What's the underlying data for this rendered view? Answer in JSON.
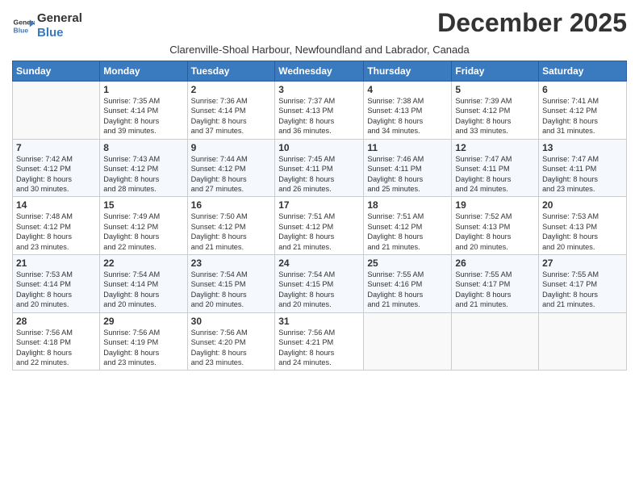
{
  "logo": {
    "line1": "General",
    "line2": "Blue"
  },
  "title": "December 2025",
  "subtitle": "Clarenville-Shoal Harbour, Newfoundland and Labrador, Canada",
  "days_of_week": [
    "Sunday",
    "Monday",
    "Tuesday",
    "Wednesday",
    "Thursday",
    "Friday",
    "Saturday"
  ],
  "weeks": [
    [
      {
        "day": "",
        "content": ""
      },
      {
        "day": "1",
        "content": "Sunrise: 7:35 AM\nSunset: 4:14 PM\nDaylight: 8 hours\nand 39 minutes."
      },
      {
        "day": "2",
        "content": "Sunrise: 7:36 AM\nSunset: 4:14 PM\nDaylight: 8 hours\nand 37 minutes."
      },
      {
        "day": "3",
        "content": "Sunrise: 7:37 AM\nSunset: 4:13 PM\nDaylight: 8 hours\nand 36 minutes."
      },
      {
        "day": "4",
        "content": "Sunrise: 7:38 AM\nSunset: 4:13 PM\nDaylight: 8 hours\nand 34 minutes."
      },
      {
        "day": "5",
        "content": "Sunrise: 7:39 AM\nSunset: 4:12 PM\nDaylight: 8 hours\nand 33 minutes."
      },
      {
        "day": "6",
        "content": "Sunrise: 7:41 AM\nSunset: 4:12 PM\nDaylight: 8 hours\nand 31 minutes."
      }
    ],
    [
      {
        "day": "7",
        "content": "Sunrise: 7:42 AM\nSunset: 4:12 PM\nDaylight: 8 hours\nand 30 minutes."
      },
      {
        "day": "8",
        "content": "Sunrise: 7:43 AM\nSunset: 4:12 PM\nDaylight: 8 hours\nand 28 minutes."
      },
      {
        "day": "9",
        "content": "Sunrise: 7:44 AM\nSunset: 4:12 PM\nDaylight: 8 hours\nand 27 minutes."
      },
      {
        "day": "10",
        "content": "Sunrise: 7:45 AM\nSunset: 4:11 PM\nDaylight: 8 hours\nand 26 minutes."
      },
      {
        "day": "11",
        "content": "Sunrise: 7:46 AM\nSunset: 4:11 PM\nDaylight: 8 hours\nand 25 minutes."
      },
      {
        "day": "12",
        "content": "Sunrise: 7:47 AM\nSunset: 4:11 PM\nDaylight: 8 hours\nand 24 minutes."
      },
      {
        "day": "13",
        "content": "Sunrise: 7:47 AM\nSunset: 4:11 PM\nDaylight: 8 hours\nand 23 minutes."
      }
    ],
    [
      {
        "day": "14",
        "content": "Sunrise: 7:48 AM\nSunset: 4:12 PM\nDaylight: 8 hours\nand 23 minutes."
      },
      {
        "day": "15",
        "content": "Sunrise: 7:49 AM\nSunset: 4:12 PM\nDaylight: 8 hours\nand 22 minutes."
      },
      {
        "day": "16",
        "content": "Sunrise: 7:50 AM\nSunset: 4:12 PM\nDaylight: 8 hours\nand 21 minutes."
      },
      {
        "day": "17",
        "content": "Sunrise: 7:51 AM\nSunset: 4:12 PM\nDaylight: 8 hours\nand 21 minutes."
      },
      {
        "day": "18",
        "content": "Sunrise: 7:51 AM\nSunset: 4:12 PM\nDaylight: 8 hours\nand 21 minutes."
      },
      {
        "day": "19",
        "content": "Sunrise: 7:52 AM\nSunset: 4:13 PM\nDaylight: 8 hours\nand 20 minutes."
      },
      {
        "day": "20",
        "content": "Sunrise: 7:53 AM\nSunset: 4:13 PM\nDaylight: 8 hours\nand 20 minutes."
      }
    ],
    [
      {
        "day": "21",
        "content": "Sunrise: 7:53 AM\nSunset: 4:14 PM\nDaylight: 8 hours\nand 20 minutes."
      },
      {
        "day": "22",
        "content": "Sunrise: 7:54 AM\nSunset: 4:14 PM\nDaylight: 8 hours\nand 20 minutes."
      },
      {
        "day": "23",
        "content": "Sunrise: 7:54 AM\nSunset: 4:15 PM\nDaylight: 8 hours\nand 20 minutes."
      },
      {
        "day": "24",
        "content": "Sunrise: 7:54 AM\nSunset: 4:15 PM\nDaylight: 8 hours\nand 20 minutes."
      },
      {
        "day": "25",
        "content": "Sunrise: 7:55 AM\nSunset: 4:16 PM\nDaylight: 8 hours\nand 21 minutes."
      },
      {
        "day": "26",
        "content": "Sunrise: 7:55 AM\nSunset: 4:17 PM\nDaylight: 8 hours\nand 21 minutes."
      },
      {
        "day": "27",
        "content": "Sunrise: 7:55 AM\nSunset: 4:17 PM\nDaylight: 8 hours\nand 21 minutes."
      }
    ],
    [
      {
        "day": "28",
        "content": "Sunrise: 7:56 AM\nSunset: 4:18 PM\nDaylight: 8 hours\nand 22 minutes."
      },
      {
        "day": "29",
        "content": "Sunrise: 7:56 AM\nSunset: 4:19 PM\nDaylight: 8 hours\nand 23 minutes."
      },
      {
        "day": "30",
        "content": "Sunrise: 7:56 AM\nSunset: 4:20 PM\nDaylight: 8 hours\nand 23 minutes."
      },
      {
        "day": "31",
        "content": "Sunrise: 7:56 AM\nSunset: 4:21 PM\nDaylight: 8 hours\nand 24 minutes."
      },
      {
        "day": "",
        "content": ""
      },
      {
        "day": "",
        "content": ""
      },
      {
        "day": "",
        "content": ""
      }
    ]
  ]
}
